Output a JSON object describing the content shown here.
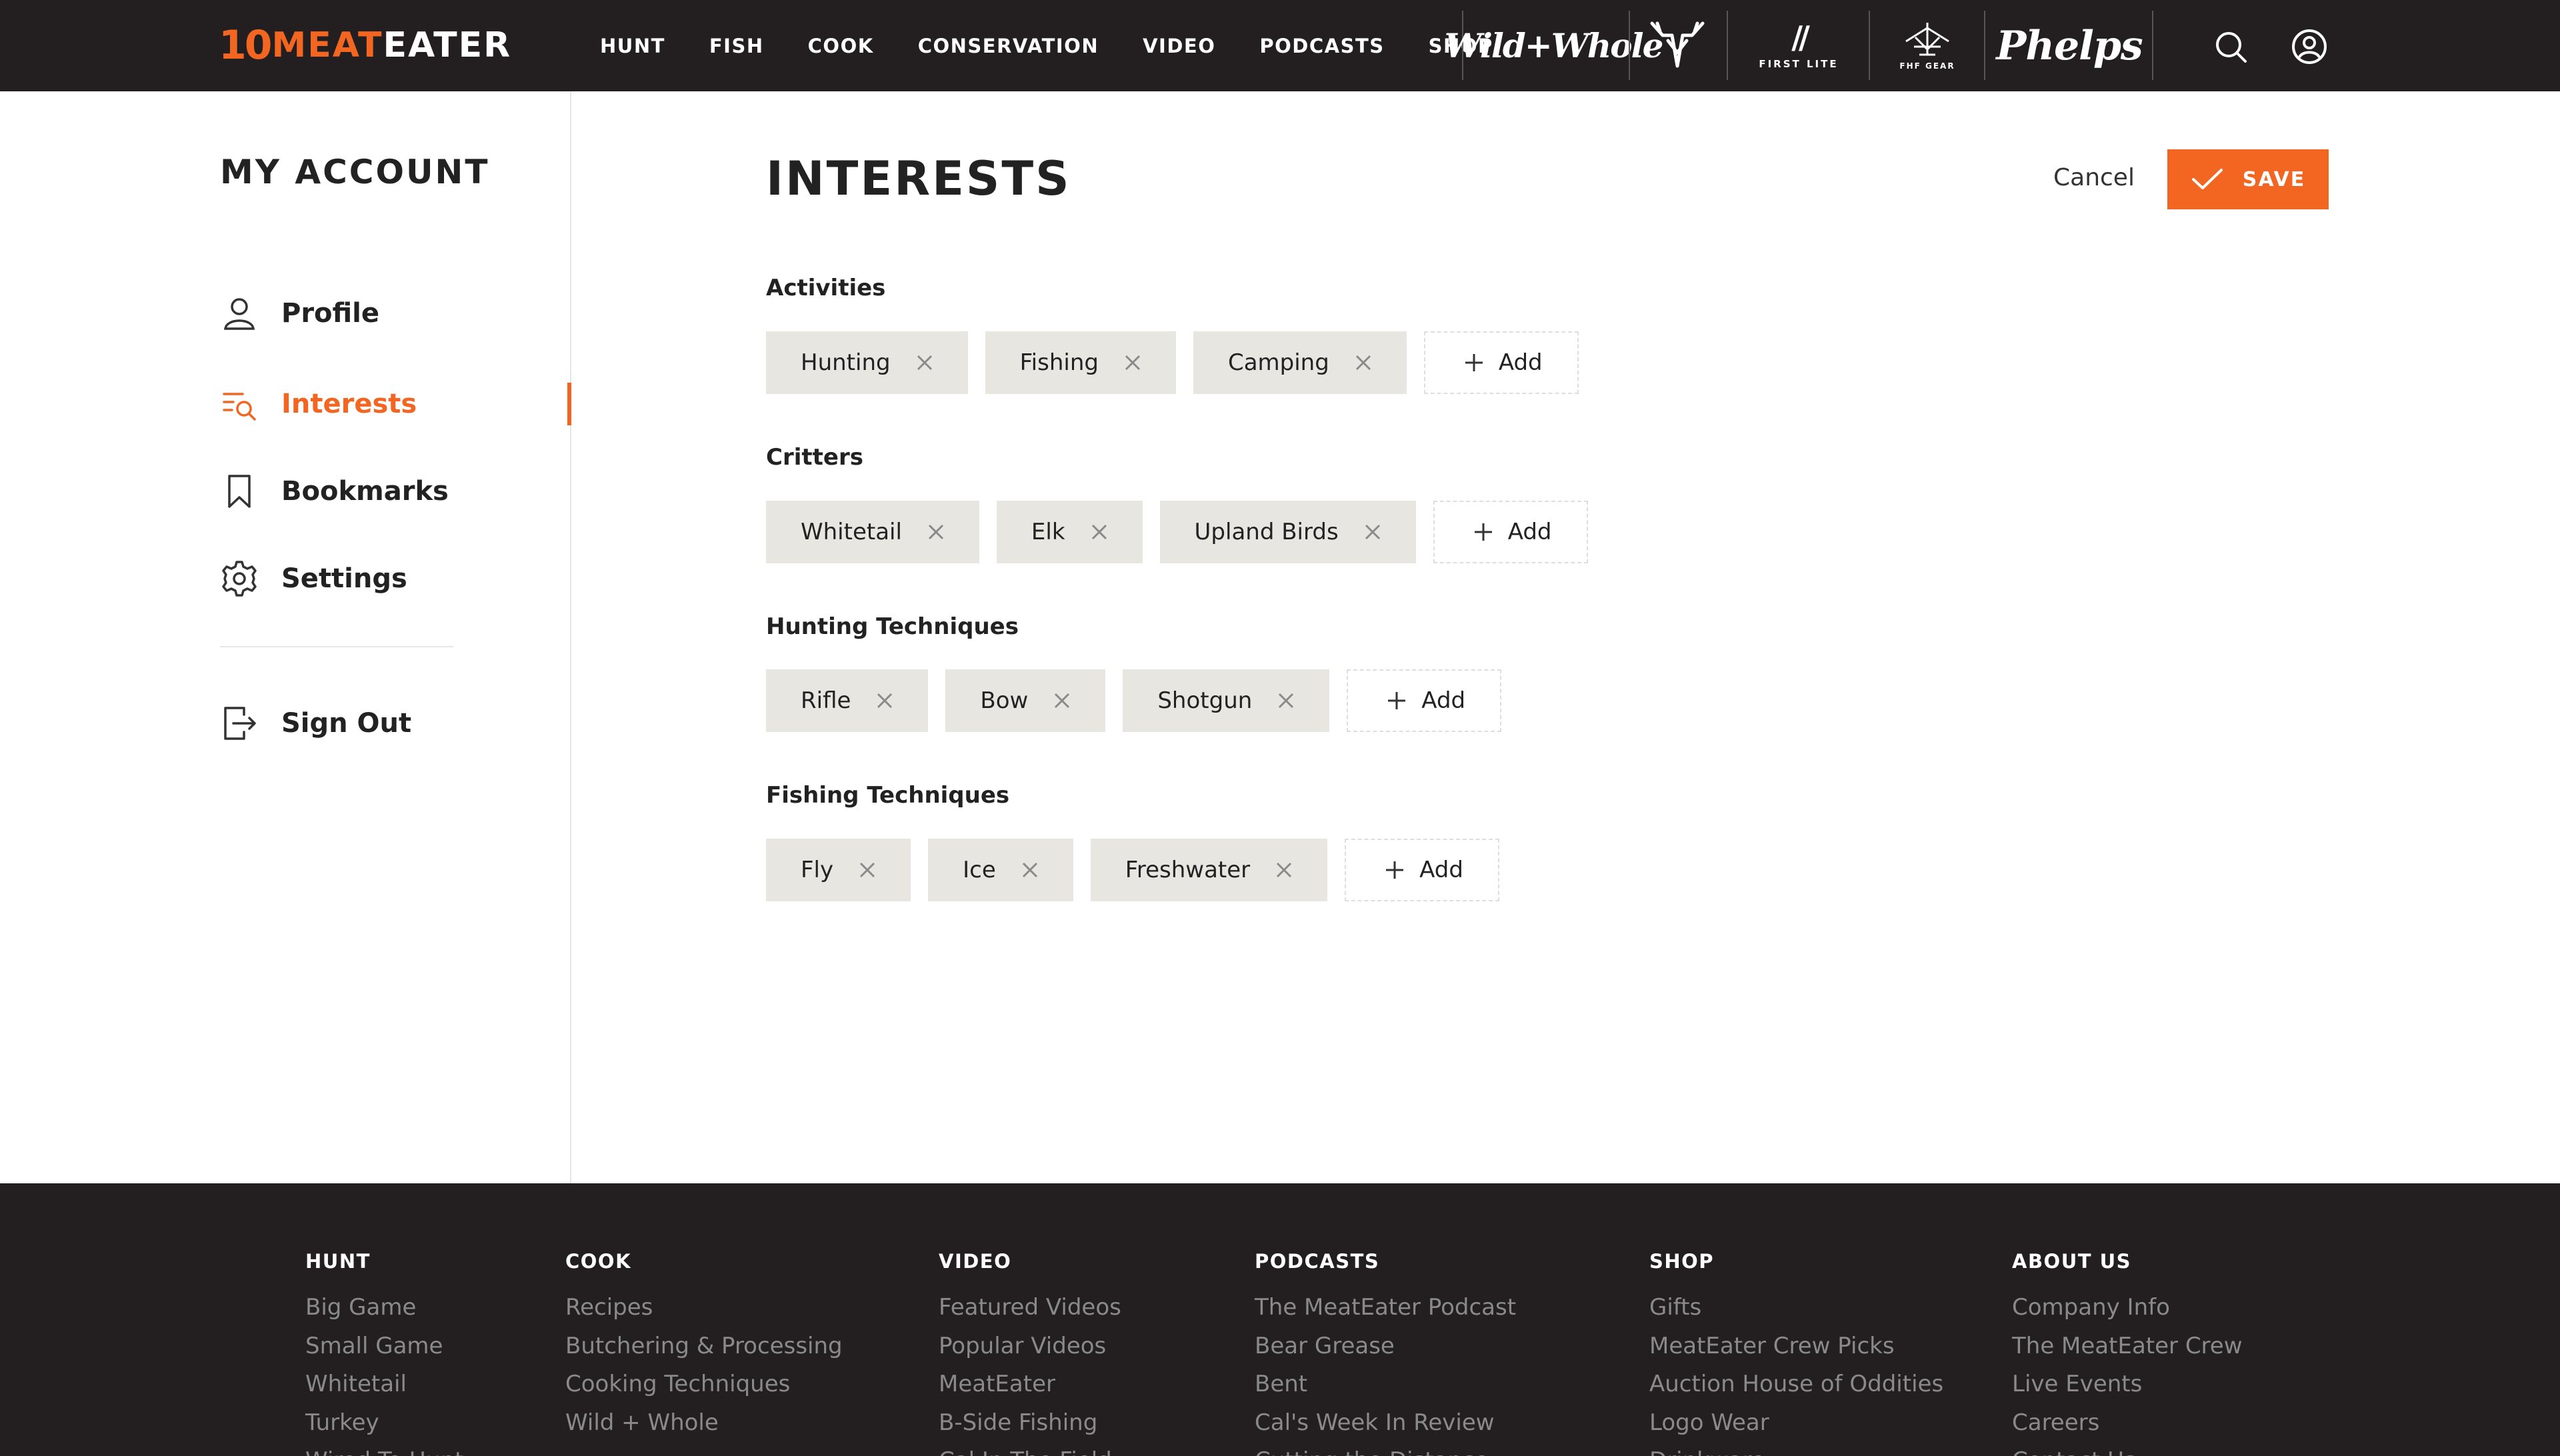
{
  "header": {
    "logo_mark": "10",
    "logo_meat": "MEAT",
    "logo_eater": "EATER",
    "nav": [
      "HUNT",
      "FISH",
      "COOK",
      "CONSERVATION",
      "VIDEO",
      "PODCASTS",
      "SHOP"
    ],
    "brand_wild": "Wild+Whole",
    "brand_firstlite_mark": "//",
    "brand_firstlite": "FIRST LITE",
    "brand_fhf": "FHF GEAR",
    "brand_phelps": "Phelps",
    "icons": [
      "search-icon",
      "account-icon"
    ]
  },
  "sidebar": {
    "title": "MY ACCOUNT",
    "items": [
      {
        "label": "Profile",
        "icon": "user-icon"
      },
      {
        "label": "Interests",
        "icon": "interests-icon",
        "active": true
      },
      {
        "label": "Bookmarks",
        "icon": "bookmark-icon"
      },
      {
        "label": "Settings",
        "icon": "gear-icon"
      }
    ],
    "sign_out": {
      "label": "Sign Out",
      "icon": "sign-out-icon"
    }
  },
  "main": {
    "title": "INTERESTS",
    "cancel_label": "Cancel",
    "save_label": "SAVE",
    "add_label": "Add",
    "sections": [
      {
        "label": "Activities",
        "chips": [
          "Hunting",
          "Fishing",
          "Camping"
        ]
      },
      {
        "label": "Critters",
        "chips": [
          "Whitetail",
          "Elk",
          "Upland Birds"
        ]
      },
      {
        "label": "Hunting Techniques",
        "chips": [
          "Rifle",
          "Bow",
          "Shotgun"
        ]
      },
      {
        "label": "Fishing Techniques",
        "chips": [
          "Fly",
          "Ice",
          "Freshwater"
        ]
      }
    ]
  },
  "footer": {
    "columns": [
      {
        "heading": "HUNT",
        "links": [
          "Big Game",
          "Small Game",
          "Whitetail",
          "Turkey",
          "Wired To Hunt"
        ]
      },
      {
        "heading": "COOK",
        "links": [
          "Recipes",
          "Butchering & Processing",
          "Cooking Techniques",
          "Wild + Whole"
        ]
      },
      {
        "heading": "VIDEO",
        "links": [
          "Featured Videos",
          "Popular Videos",
          "MeatEater",
          "B-Side Fishing",
          "Cal In The Field"
        ]
      },
      {
        "heading": "PODCASTS",
        "links": [
          "The MeatEater Podcast",
          "Bear Grease",
          "Bent",
          "Cal's Week In Review",
          "Cutting the Distance"
        ]
      },
      {
        "heading": "SHOP",
        "links": [
          "Gifts",
          "MeatEater Crew Picks",
          "Auction House of Oddities",
          "Logo Wear",
          "Drinkware"
        ]
      },
      {
        "heading": "ABOUT US",
        "links": [
          "Company Info",
          "The MeatEater Crew",
          "Live Events",
          "Careers",
          "Contact Us"
        ]
      }
    ]
  },
  "colors": {
    "accent": "#f26622",
    "nav_bg": "#231f20",
    "chip_bg": "#e8e6e1"
  }
}
